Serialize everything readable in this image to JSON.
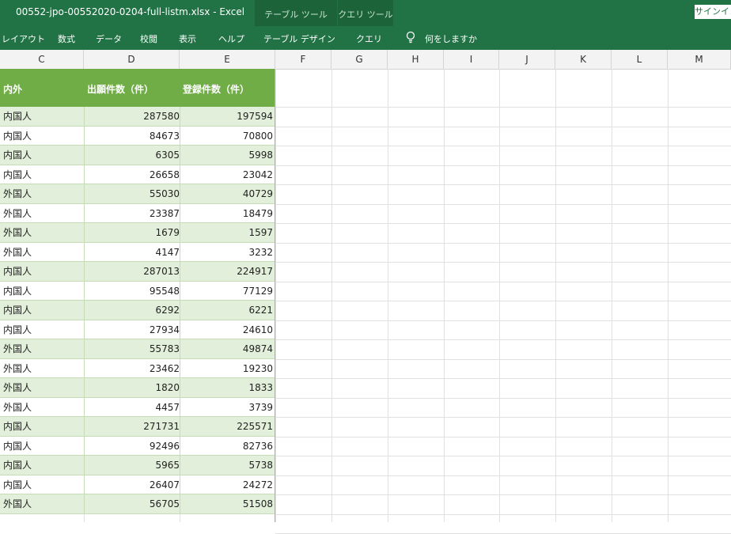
{
  "window": {
    "title": "00552-jpo-00552020-0204-full-listm.xlsx  -  Excel",
    "context_tabs": [
      "テーブル ツール",
      "クエリ ツール"
    ],
    "signin_label": "サインイン"
  },
  "ribbon": {
    "tabs": [
      "レイアウト",
      "数式",
      "データ",
      "校閲",
      "表示",
      "ヘルプ",
      "テーブル デザイン",
      "クエリ"
    ],
    "search_placeholder": "何をしますか"
  },
  "columns": [
    "C",
    "D",
    "E",
    "F",
    "G",
    "H",
    "I",
    "J",
    "K",
    "L",
    "M"
  ],
  "table": {
    "headers": [
      "内外",
      "出願件数（件）",
      "登録件数（件）"
    ],
    "rows": [
      [
        "内国人",
        "287580",
        "197594"
      ],
      [
        "内国人",
        "84673",
        "70800"
      ],
      [
        "内国人",
        "6305",
        "5998"
      ],
      [
        "内国人",
        "26658",
        "23042"
      ],
      [
        "外国人",
        "55030",
        "40729"
      ],
      [
        "外国人",
        "23387",
        "18479"
      ],
      [
        "外国人",
        "1679",
        "1597"
      ],
      [
        "外国人",
        "4147",
        "3232"
      ],
      [
        "内国人",
        "287013",
        "224917"
      ],
      [
        "内国人",
        "95548",
        "77129"
      ],
      [
        "内国人",
        "6292",
        "6221"
      ],
      [
        "内国人",
        "27934",
        "24610"
      ],
      [
        "外国人",
        "55783",
        "49874"
      ],
      [
        "外国人",
        "23462",
        "19230"
      ],
      [
        "外国人",
        "1820",
        "1833"
      ],
      [
        "外国人",
        "4457",
        "3739"
      ],
      [
        "内国人",
        "271731",
        "225571"
      ],
      [
        "内国人",
        "92496",
        "82736"
      ],
      [
        "内国人",
        "5965",
        "5738"
      ],
      [
        "内国人",
        "26407",
        "24272"
      ],
      [
        "外国人",
        "56705",
        "51508"
      ]
    ]
  },
  "colors": {
    "excel_green": "#217346",
    "table_header": "#70ad47",
    "band": "#e2efda"
  }
}
